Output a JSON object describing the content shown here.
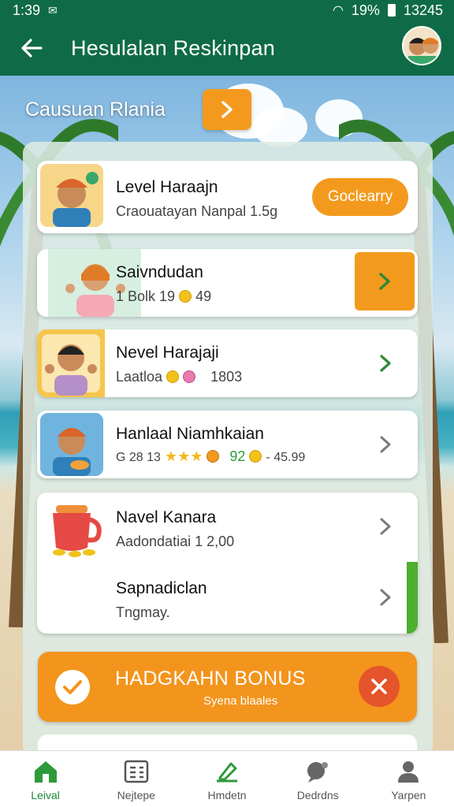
{
  "status_bar": {
    "time": "1:39",
    "battery": "19%",
    "clock": "13245"
  },
  "app_bar": {
    "title": "Hesulalan Reskinpan"
  },
  "section": {
    "title": "Causuan Rlania"
  },
  "cards": [
    {
      "name": "Level Haraajn",
      "sub": "Craouatayan Nanpal 1.5g",
      "action_label": "Goclearry"
    },
    {
      "name": "Saivndudan",
      "sub_prefix": "1 Bolk 19",
      "sub_suffix": "49"
    },
    {
      "name": "Nevel Harajaji",
      "sub_prefix": "Laatloa",
      "sub_suffix": "1803"
    },
    {
      "name": "Hanlaal Niamhkaian",
      "sub_prefix": "G 28 13",
      "sub_green": "92",
      "sub_suffix": "- 45.99"
    },
    {
      "name": "Navel Kanara",
      "sub": "Aadondatiai 1 2,00"
    },
    {
      "name": "Sapnadiclan",
      "sub": "Tngmay."
    }
  ],
  "bonus": {
    "title": "HADGKAHN BONUS",
    "subtitle": "Syena blaales"
  },
  "bottom_nav": [
    {
      "label": "Leival",
      "icon": "home-icon",
      "active": true
    },
    {
      "label": "Nejtepe",
      "icon": "list-card-icon",
      "active": false
    },
    {
      "label": "Hmdetn",
      "icon": "edit-icon",
      "active": false
    },
    {
      "label": "Dedrdns",
      "icon": "chat-icon",
      "active": false
    },
    {
      "label": "Yarpen",
      "icon": "profile-icon",
      "active": false
    }
  ],
  "colors": {
    "primary_green": "#0f6b47",
    "accent_orange": "#f39a1e",
    "close_red": "#e5542a",
    "nav_active": "#1b8b3a"
  }
}
